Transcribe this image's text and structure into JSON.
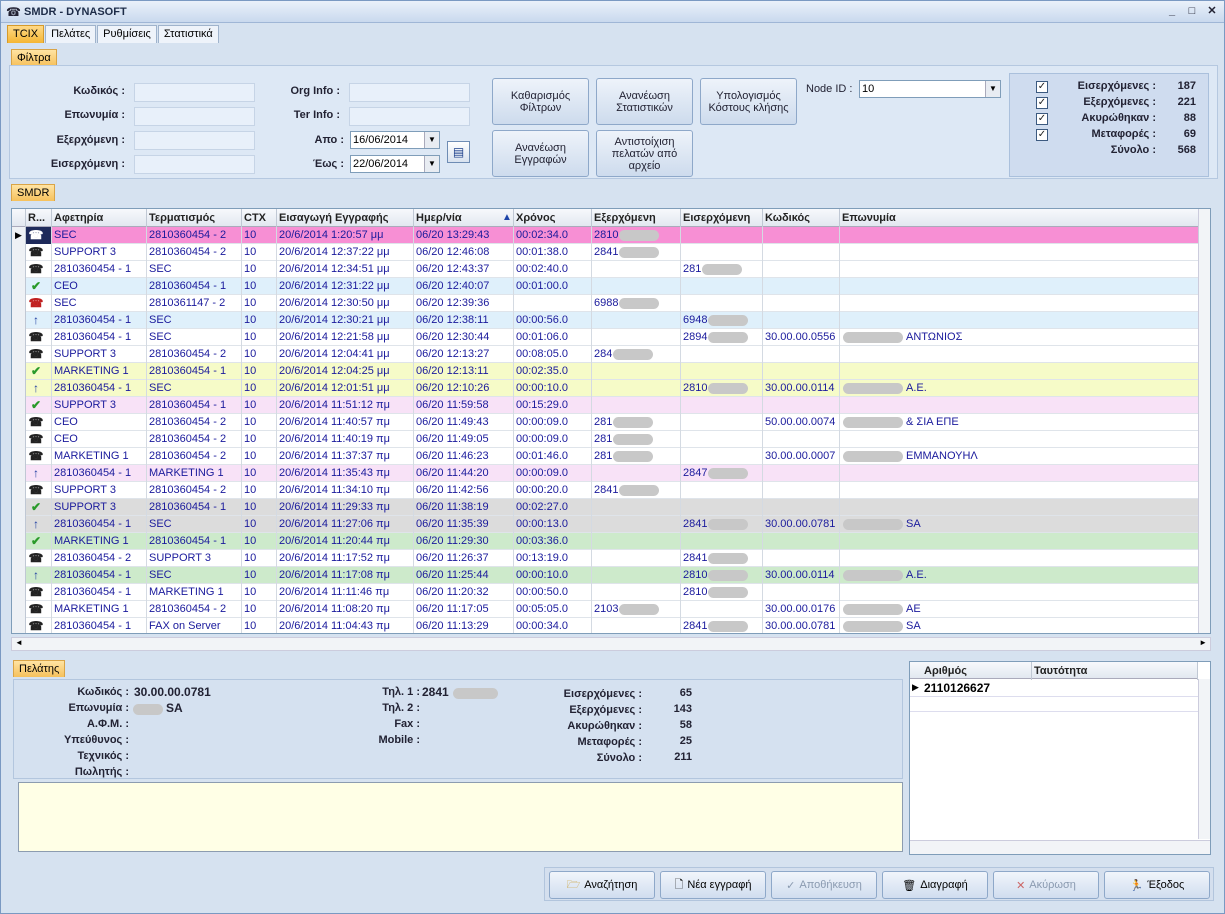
{
  "window": {
    "title": "SMDR - DYNASOFT",
    "controls": [
      "_",
      "□",
      "✕"
    ]
  },
  "tabs": [
    "TCIX",
    "Πελάτες",
    "Ρυθμίσεις",
    "Στατιστικά"
  ],
  "filters": {
    "section": "Φίλτρα",
    "code": "Κωδικός :",
    "surname": "Επωνυμία :",
    "outgoing": "Εξερχόμενη :",
    "incoming": "Εισερχόμενη :",
    "org": "Org Info :",
    "ter": "Ter Info :",
    "from": "Απο :",
    "to": "Έως :",
    "from_val": "16/06/2014",
    "to_val": "22/06/2014",
    "btn_clear": "Καθαρισμός Φίλτρων",
    "btn_stats": "Ανανέωση Στατιστικών",
    "btn_cost": "Υπολογισμός Κόστους κλήσης",
    "btn_refresh": "Ανανέωση Εγγραφών",
    "btn_match": "Αντιστοίχιση πελατών από αρχείο",
    "node_label": "Node ID :",
    "node_val": "10"
  },
  "stats": [
    {
      "label": "Εισερχόμενες :",
      "value": "187",
      "chk": true
    },
    {
      "label": "Εξερχόμενες :",
      "value": "221",
      "chk": true
    },
    {
      "label": "Ακυρώθηκαν :",
      "value": "88",
      "chk": true
    },
    {
      "label": "Μεταφορές :",
      "value": "69",
      "chk": true
    },
    {
      "label": "Σύνολο :",
      "value": "568",
      "chk": false
    }
  ],
  "smdr": {
    "section": "SMDR",
    "columns": [
      "R...",
      "Αφετηρία",
      "Τερματισμός",
      "CTX",
      "Εισαγωγή Εγγραφής",
      "Ημερ/νία",
      "Χρόνος",
      "Εξερχόμενη",
      "Εισερχόμενη",
      "Κωδικός",
      "Επωνυμία"
    ],
    "rows": [
      {
        "ico": "phone-black",
        "from": "SEC",
        "to": "2810360454 - 2",
        "ctx": "10",
        "ins": "20/6/2014 1:20:57 μμ",
        "date": "06/20 13:29:43",
        "dur": "00:02:34.0",
        "out": "2810",
        "in": "",
        "code": "",
        "name": "",
        "bg": "#f78fd4",
        "sel": true
      },
      {
        "ico": "phone",
        "from": "SUPPORT 3",
        "to": "2810360454 - 2",
        "ctx": "10",
        "ins": "20/6/2014 12:37:22 μμ",
        "date": "06/20 12:46:08",
        "dur": "00:01:38.0",
        "out": "2841",
        "in": "",
        "code": "",
        "name": "",
        "bg": "#ffffff"
      },
      {
        "ico": "phone",
        "from": "2810360454 - 1",
        "to": "SEC",
        "ctx": "10",
        "ins": "20/6/2014 12:34:51 μμ",
        "date": "06/20 12:43:37",
        "dur": "00:02:40.0",
        "out": "",
        "in": "281",
        "code": "",
        "name": "",
        "bg": "#ffffff"
      },
      {
        "ico": "check",
        "from": "CEO",
        "to": "2810360454 - 1",
        "ctx": "10",
        "ins": "20/6/2014 12:31:22 μμ",
        "date": "06/20 12:40:07",
        "dur": "00:01:00.0",
        "out": "",
        "in": "",
        "code": "",
        "name": "",
        "bg": "#dff0fb"
      },
      {
        "ico": "phone-red",
        "from": "SEC",
        "to": "2810361147 - 2",
        "ctx": "10",
        "ins": "20/6/2014 12:30:50 μμ",
        "date": "06/20 12:39:36",
        "dur": "",
        "out": "6988",
        "in": "",
        "code": "",
        "name": "",
        "bg": "#ffffff"
      },
      {
        "ico": "arrow",
        "from": "2810360454 - 1",
        "to": "SEC",
        "ctx": "10",
        "ins": "20/6/2014 12:30:21 μμ",
        "date": "06/20 12:38:11",
        "dur": "00:00:56.0",
        "out": "",
        "in": "6948",
        "code": "",
        "name": "",
        "bg": "#dff0fb"
      },
      {
        "ico": "phone",
        "from": "2810360454 - 1",
        "to": "SEC",
        "ctx": "10",
        "ins": "20/6/2014 12:21:58 μμ",
        "date": "06/20 12:30:44",
        "dur": "00:01:06.0",
        "out": "",
        "in": "2894",
        "code": "30.00.00.0556",
        "name": "ΑΝΤΩΝΙΟΣ",
        "bg": "#ffffff"
      },
      {
        "ico": "phone",
        "from": "SUPPORT 3",
        "to": "2810360454 - 2",
        "ctx": "10",
        "ins": "20/6/2014 12:04:41 μμ",
        "date": "06/20 12:13:27",
        "dur": "00:08:05.0",
        "out": "284",
        "in": "",
        "code": "",
        "name": "",
        "bg": "#ffffff"
      },
      {
        "ico": "check",
        "from": "MARKETING 1",
        "to": "2810360454 - 1",
        "ctx": "10",
        "ins": "20/6/2014 12:04:25 μμ",
        "date": "06/20 12:13:11",
        "dur": "00:02:35.0",
        "out": "",
        "in": "",
        "code": "",
        "name": "",
        "bg": "#f6fbc8"
      },
      {
        "ico": "arrow",
        "from": "2810360454 - 1",
        "to": "SEC",
        "ctx": "10",
        "ins": "20/6/2014 12:01:51 μμ",
        "date": "06/20 12:10:26",
        "dur": "00:00:10.0",
        "out": "",
        "in": "2810",
        "code": "30.00.00.0114",
        "name": "Α.Ε.",
        "bg": "#f6fbc8"
      },
      {
        "ico": "check",
        "from": "SUPPORT 3",
        "to": "2810360454 - 1",
        "ctx": "10",
        "ins": "20/6/2014 11:51:12 πμ",
        "date": "06/20 11:59:58",
        "dur": "00:15:29.0",
        "out": "",
        "in": "",
        "code": "",
        "name": "",
        "bg": "#f8e2f7"
      },
      {
        "ico": "phone",
        "from": "CEO",
        "to": "2810360454 - 2",
        "ctx": "10",
        "ins": "20/6/2014 11:40:57 πμ",
        "date": "06/20 11:49:43",
        "dur": "00:00:09.0",
        "out": "281",
        "in": "",
        "code": "50.00.00.0074",
        "name": "& ΣΙΑ ΕΠΕ",
        "bg": "#ffffff"
      },
      {
        "ico": "phone",
        "from": "CEO",
        "to": "2810360454 - 2",
        "ctx": "10",
        "ins": "20/6/2014 11:40:19 πμ",
        "date": "06/20 11:49:05",
        "dur": "00:00:09.0",
        "out": "281",
        "in": "",
        "code": "",
        "name": "",
        "bg": "#ffffff"
      },
      {
        "ico": "phone",
        "from": "MARKETING 1",
        "to": "2810360454 - 2",
        "ctx": "10",
        "ins": "20/6/2014 11:37:37 πμ",
        "date": "06/20 11:46:23",
        "dur": "00:01:46.0",
        "out": "281",
        "in": "",
        "code": "30.00.00.0007",
        "name": "ΕΜΜΑΝΟΥΗΛ",
        "bg": "#ffffff"
      },
      {
        "ico": "arrow",
        "from": "2810360454 - 1",
        "to": "MARKETING 1",
        "ctx": "10",
        "ins": "20/6/2014 11:35:43 πμ",
        "date": "06/20 11:44:20",
        "dur": "00:00:09.0",
        "out": "",
        "in": "2847",
        "code": "",
        "name": "",
        "bg": "#f8e2f7"
      },
      {
        "ico": "phone",
        "from": "SUPPORT 3",
        "to": "2810360454 - 2",
        "ctx": "10",
        "ins": "20/6/2014 11:34:10 πμ",
        "date": "06/20 11:42:56",
        "dur": "00:00:20.0",
        "out": "2841",
        "in": "",
        "code": "",
        "name": "",
        "bg": "#ffffff"
      },
      {
        "ico": "check",
        "from": "SUPPORT 3",
        "to": "2810360454 - 1",
        "ctx": "10",
        "ins": "20/6/2014 11:29:33 πμ",
        "date": "06/20 11:38:19",
        "dur": "00:02:27.0",
        "out": "",
        "in": "",
        "code": "",
        "name": "",
        "bg": "#dcdcdc"
      },
      {
        "ico": "arrow",
        "from": "2810360454 - 1",
        "to": "SEC",
        "ctx": "10",
        "ins": "20/6/2014 11:27:06 πμ",
        "date": "06/20 11:35:39",
        "dur": "00:00:13.0",
        "out": "",
        "in": "2841",
        "code": "30.00.00.0781",
        "name": "SA",
        "bg": "#dcdcdc"
      },
      {
        "ico": "check",
        "from": "MARKETING 1",
        "to": "2810360454 - 1",
        "ctx": "10",
        "ins": "20/6/2014 11:20:44 πμ",
        "date": "06/20 11:29:30",
        "dur": "00:03:36.0",
        "out": "",
        "in": "",
        "code": "",
        "name": "",
        "bg": "#cdeacb"
      },
      {
        "ico": "phone",
        "from": "2810360454 - 2",
        "to": "SUPPORT 3",
        "ctx": "10",
        "ins": "20/6/2014 11:17:52 πμ",
        "date": "06/20 11:26:37",
        "dur": "00:13:19.0",
        "out": "",
        "in": "2841",
        "code": "",
        "name": "",
        "bg": "#ffffff"
      },
      {
        "ico": "arrow",
        "from": "2810360454 - 1",
        "to": "SEC",
        "ctx": "10",
        "ins": "20/6/2014 11:17:08 πμ",
        "date": "06/20 11:25:44",
        "dur": "00:00:10.0",
        "out": "",
        "in": "2810",
        "code": "30.00.00.0114",
        "name": "Α.Ε.",
        "bg": "#cdeacb"
      },
      {
        "ico": "phone",
        "from": "2810360454 - 1",
        "to": "MARKETING 1",
        "ctx": "10",
        "ins": "20/6/2014 11:11:46 πμ",
        "date": "06/20 11:20:32",
        "dur": "00:00:50.0",
        "out": "",
        "in": "2810",
        "code": "",
        "name": "",
        "bg": "#ffffff"
      },
      {
        "ico": "phone",
        "from": "MARKETING 1",
        "to": "2810360454 - 2",
        "ctx": "10",
        "ins": "20/6/2014 11:08:20 πμ",
        "date": "06/20 11:17:05",
        "dur": "00:05:05.0",
        "out": "2103",
        "in": "",
        "code": "30.00.00.0176",
        "name": "ΑΕ",
        "bg": "#ffffff"
      },
      {
        "ico": "phone",
        "from": "2810360454 - 1",
        "to": "FAX on Server",
        "ctx": "10",
        "ins": "20/6/2014 11:04:43 πμ",
        "date": "06/20 11:13:29",
        "dur": "00:00:34.0",
        "out": "",
        "in": "2841",
        "code": "30.00.00.0781",
        "name": "SA",
        "bg": "#ffffff"
      }
    ]
  },
  "customer": {
    "section": "Πελάτης",
    "labels": [
      "Κωδικός :",
      "Επωνυμία :",
      "Α.Φ.Μ. :",
      "Υπεύθυνος :",
      "Τεχνικός :",
      "Πωλητής :"
    ],
    "code": "30.00.00.0781",
    "name": "SA",
    "tel_labels": [
      "Τηλ. 1 :",
      "Τηλ. 2 :",
      "Fax :",
      "Mobile :"
    ],
    "tel1": "2841",
    "stat_labels": [
      "Εισερχόμενες :",
      "Εξερχόμενες :",
      "Ακυρώθηκαν :",
      "Μεταφορές :",
      "Σύνολο :"
    ],
    "stat_vals": [
      "65",
      "143",
      "58",
      "25",
      "211"
    ]
  },
  "numbers": {
    "cols": [
      "Αριθμός",
      "Ταυτότητα"
    ],
    "row": "2110126627"
  },
  "actions": {
    "search": "Αναζήτηση",
    "new": "Νέα εγγραφή",
    "save": "Αποθήκευση",
    "delete": "Διαγραφή",
    "cancel": "Ακύρωση",
    "exit": "Έξοδος"
  }
}
